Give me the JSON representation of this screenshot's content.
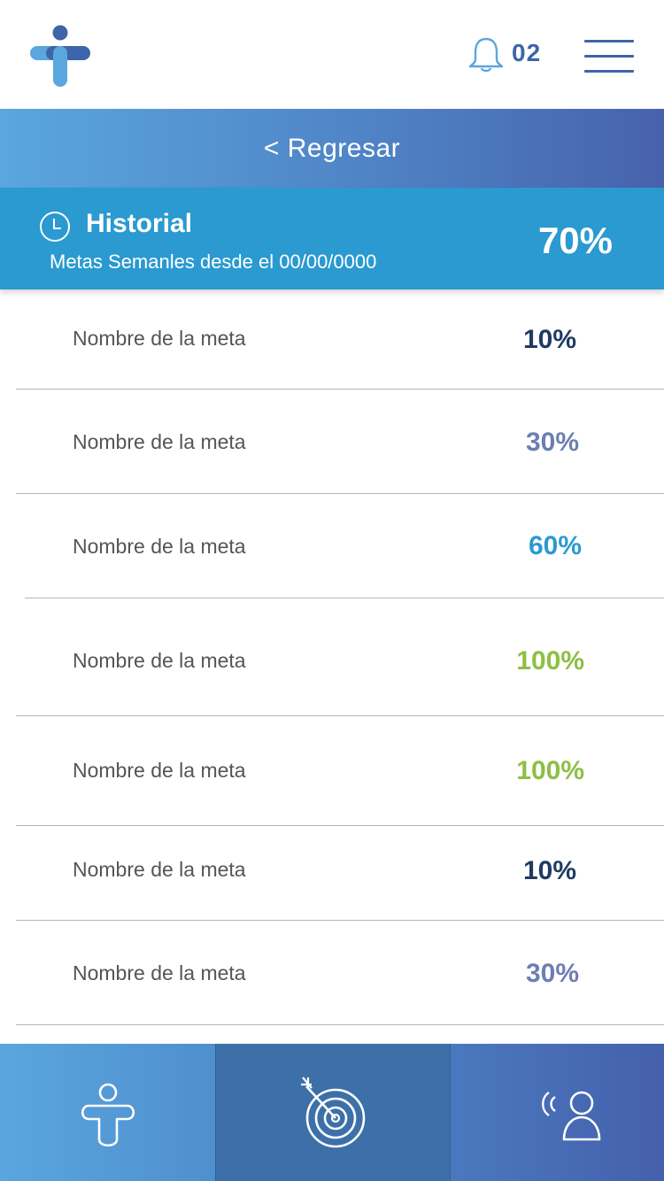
{
  "header": {
    "notification_count": "02",
    "logo_icon": "cross-person-logo",
    "bell_icon": "bell-icon",
    "menu_icon": "hamburger-menu-icon"
  },
  "backbar": {
    "label": "< Regresar"
  },
  "historial": {
    "title": "Historial",
    "subtitle": "Metas Semanles desde el 00/00/0000",
    "percent": "70%",
    "icon": "clock-icon"
  },
  "goals": [
    {
      "label": "Nombre de la meta",
      "percent": "10%",
      "color": "#1d3b63"
    },
    {
      "label": "Nombre de la meta",
      "percent": "30%",
      "color": "#6b7fb2"
    },
    {
      "label": "Nombre de la meta",
      "percent": "60%",
      "color": "#2a9ad0"
    },
    {
      "label": "Nombre de la meta",
      "percent": "100%",
      "color": "#8cbf44"
    },
    {
      "label": "Nombre de la meta",
      "percent": "100%",
      "color": "#8cbf44"
    },
    {
      "label": "Nombre de la meta",
      "percent": "10%",
      "color": "#1d3b63"
    },
    {
      "label": "Nombre de la meta",
      "percent": "30%",
      "color": "#6b7fb2"
    }
  ],
  "bottom_nav": [
    {
      "icon": "person-icon"
    },
    {
      "icon": "target-icon"
    },
    {
      "icon": "contact-person-icon"
    }
  ],
  "colors": {
    "brand_blue": "#3e65aa",
    "accent_blue": "#2a9ad0",
    "light_blue": "#5aa6de",
    "green": "#8cbf44"
  }
}
